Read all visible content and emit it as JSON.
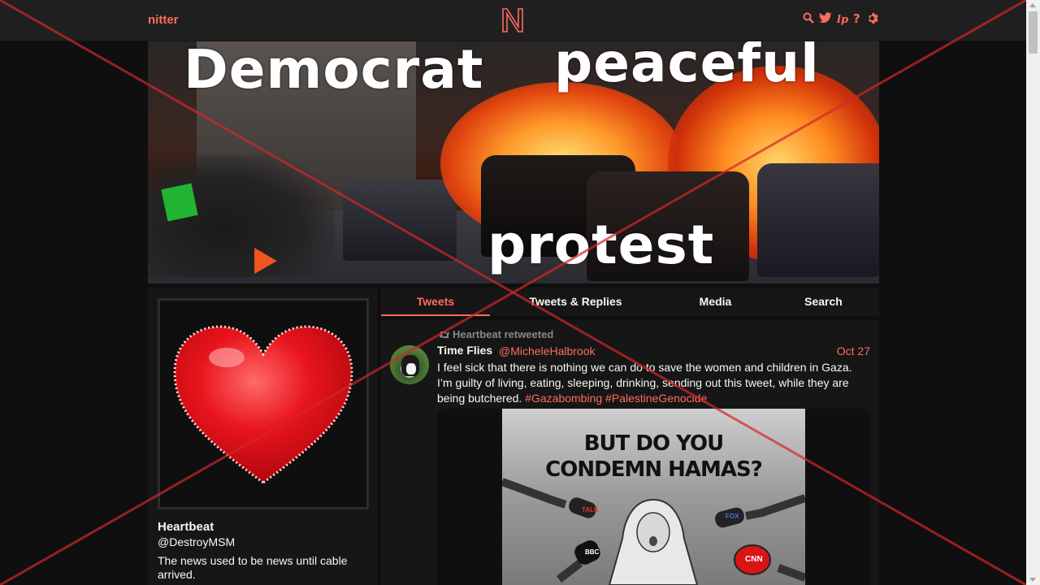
{
  "nav": {
    "brand": "nitter",
    "logo_letter": "N",
    "icons": [
      "search-icon",
      "twitter-icon",
      "lp-icon",
      "help-icon",
      "settings-icon"
    ],
    "accent": "#ff6c60"
  },
  "banner": {
    "words": [
      "Democrat",
      "peaceful",
      "protest"
    ]
  },
  "profile": {
    "fullname": "Heartbeat",
    "username": "@DestroyMSM",
    "bio": "The news used to be news until cable arrived."
  },
  "tabs": [
    {
      "label": "Tweets",
      "active": true
    },
    {
      "label": "Tweets & Replies",
      "active": false
    },
    {
      "label": "Media",
      "active": false
    },
    {
      "label": "Search",
      "active": false
    }
  ],
  "tweet": {
    "retweet_label": "Heartbeat retweeted",
    "name": "Time Flies",
    "handle": "@MicheleHalbrook",
    "date": "Oct 27",
    "text": "I feel sick that there is nothing we can do to save the women and children in Gaza. I’m guilty of living, eating, sleeping, drinking, sending out this tweet, while they are being butchered.",
    "hashtags": [
      "#Gazabombing",
      "#PalestineGenocide"
    ],
    "media_caption_lines": [
      "BUT DO YOU",
      "CONDEMN HAMAS?"
    ],
    "mic_labels": [
      "TALK",
      "FOX",
      "BBC",
      "CNN"
    ]
  },
  "colors": {
    "background": "#0f0f0f",
    "panel": "#161616",
    "navbar": "#1f1f1f",
    "text": "#f8f8f2",
    "muted": "#888889",
    "overlay_cross": "#d0282c"
  }
}
